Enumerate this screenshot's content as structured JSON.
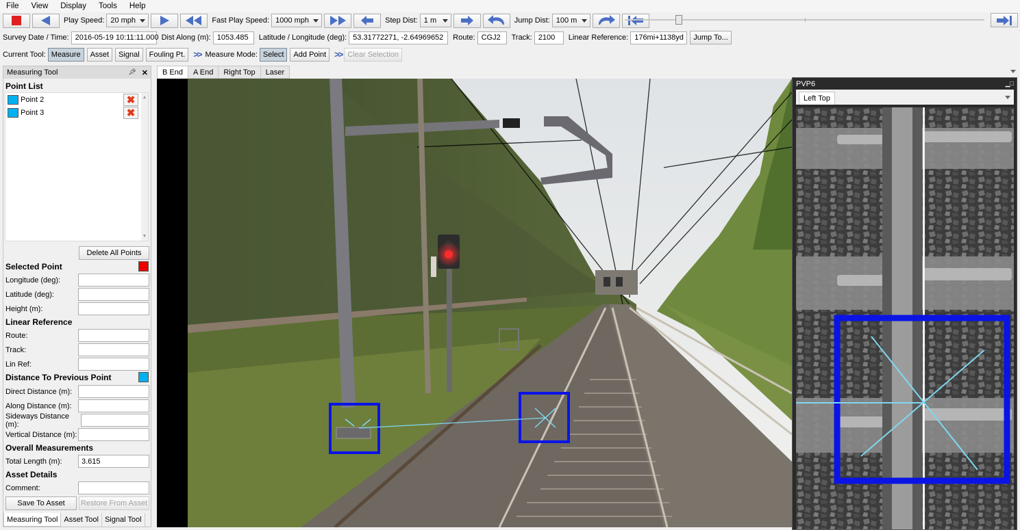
{
  "menu": [
    "File",
    "View",
    "Display",
    "Tools",
    "Help"
  ],
  "toolbar": {
    "play_speed_label": "Play Speed:",
    "play_speed_value": "20 mph",
    "fast_play_speed_label": "Fast Play Speed:",
    "fast_play_speed_value": "1000 mph",
    "step_dist_label": "Step Dist:",
    "step_dist_value": "1 m",
    "jump_dist_label": "Jump Dist:",
    "jump_dist_value": "100 m",
    "position_fraction": 0.15
  },
  "info": {
    "survey_label": "Survey Date / Time:",
    "survey_value": "2016-05-19 10:11:11.000",
    "dist_label": "Dist Along (m):",
    "dist_value": "1053.485",
    "latlon_label": "Latitude / Longitude (deg):",
    "latlon_value": "53.31772271, -2.64969652",
    "route_label": "Route:",
    "route_value": "CGJ2",
    "track_label": "Track:",
    "track_value": "2100",
    "linref_label": "Linear Reference:",
    "linref_value": "176mi+1138yd",
    "jump_button": "Jump To..."
  },
  "tools": {
    "current_label": "Current Tool:",
    "measure": "Measure",
    "asset": "Asset",
    "signal": "Signal",
    "fouling": "Fouling Pt.",
    "mode_label": "Measure Mode:",
    "select": "Select",
    "add_point": "Add Point",
    "clear_selection": "Clear Selection"
  },
  "panel": {
    "title": "Measuring Tool",
    "point_list": "Point List",
    "points": [
      {
        "name": "Point 2",
        "color": "#00b0f0"
      },
      {
        "name": "Point 3",
        "color": "#00b0f0"
      }
    ],
    "delete_all": "Delete All Points",
    "selected_point": "Selected Point",
    "selected_color": "#ee0000",
    "longitude": "Longitude (deg):",
    "latitude": "Latitude (deg):",
    "height": "Height (m):",
    "linear_reference": "Linear Reference",
    "route": "Route:",
    "track": "Track:",
    "lin_ref": "Lin Ref:",
    "distance_prev": "Distance To Previous Point",
    "distance_color": "#00b0f0",
    "direct": "Direct Distance (m):",
    "along": "Along Distance (m):",
    "sideways": "Sideways Distance (m):",
    "vertical": "Vertical Distance (m):",
    "overall": "Overall Measurements",
    "total_length_label": "Total Length (m):",
    "total_length_value": "3.615",
    "asset_details": "Asset Details",
    "comment": "Comment:",
    "save_asset": "Save To Asset",
    "restore_asset": "Restore From Asset",
    "tabs": [
      "Measuring Tool",
      "Asset Tool",
      "Signal Tool"
    ]
  },
  "view": {
    "tabs": [
      "B End",
      "A End",
      "Right Top",
      "Laser"
    ]
  },
  "pvp": {
    "title": "PVP6",
    "tab": "Left Top"
  },
  "colors": {
    "marker_box": "#0a14e6",
    "marker_cross": "#7fd8f0",
    "signal_red": "#ff2020"
  }
}
